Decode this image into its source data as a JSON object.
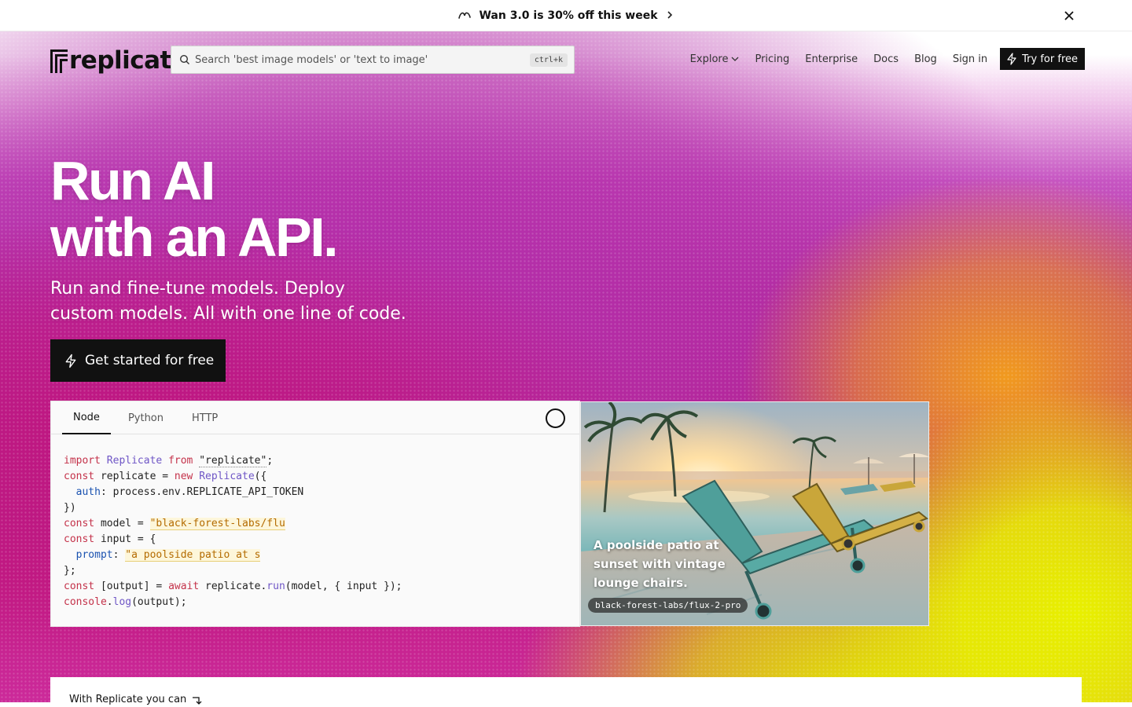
{
  "announcement": {
    "text": "Wan 3.0 is 30% off this week",
    "icon": "wan-logo-icon",
    "close_label": "×"
  },
  "nav": {
    "logo_text": "replicate",
    "search_placeholder": "Search 'best image models' or 'text to image'",
    "search_shortcut": "ctrl+k",
    "links": [
      "Explore",
      "Pricing",
      "Enterprise",
      "Docs",
      "Blog",
      "Sign in"
    ],
    "cta_label": "Try for free"
  },
  "hero": {
    "title_line1": "Run AI",
    "title_line2": "with an API.",
    "subtitle_line1": "Run and fine-tune models. Deploy",
    "subtitle_line2": "custom models. All with one line of code.",
    "cta_label": "Get started for free"
  },
  "code": {
    "tabs": [
      "Node",
      "Python",
      "HTTP"
    ],
    "active_tab": "Node",
    "lines": {
      "l1": [
        "import",
        "Replicate",
        "from",
        "\"replicate\"",
        ";"
      ],
      "l2": [
        "const",
        " replicate = ",
        "new",
        "Replicate",
        "({"
      ],
      "l3": [
        "auth",
        ": process.env.REPLICATE_API_TOKEN"
      ],
      "l4": "})",
      "l5": [
        "const",
        " model = ",
        "\"black-forest-labs/flu"
      ],
      "l6": [
        "const",
        " input = {"
      ],
      "l7": [
        "prompt",
        ": ",
        "\"a poolside patio at s"
      ],
      "l8": "};",
      "l9": [
        "const",
        " [output] = ",
        "await",
        " replicate.",
        "run",
        "(model, { input });"
      ],
      "l10": [
        "console",
        ".",
        "log",
        "(output);"
      ]
    }
  },
  "preview": {
    "caption": "A poolside patio at sunset with vintage lounge chairs.",
    "model_tag": "black-forest-labs/flux-2-pro"
  },
  "bottom": {
    "text": "With Replicate you can"
  },
  "colors": {
    "nav_cta_bg": "#111111",
    "hero_magenta": "#b42ea9",
    "hero_yellow": "#e8f000",
    "hero_orange": "#f19a1e"
  }
}
